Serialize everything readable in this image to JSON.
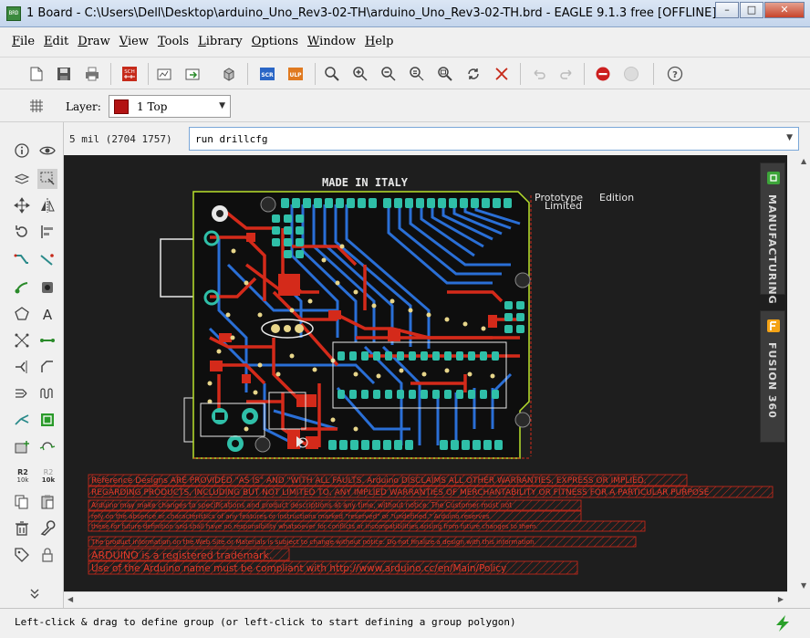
{
  "window": {
    "app_icon_label": "BRD",
    "title": "1 Board - C:\\Users\\Dell\\Desktop\\arduino_Uno_Rev3-02-TH\\arduino_Uno_Rev3-02-TH.brd - EAGLE 9.1.3 free [OFFLINE]",
    "minimize": "–",
    "maximize": "□",
    "close": "✕"
  },
  "menu": [
    {
      "first": "F",
      "rest": "ile"
    },
    {
      "first": "E",
      "rest": "dit"
    },
    {
      "first": "D",
      "rest": "raw"
    },
    {
      "first": "V",
      "rest": "iew"
    },
    {
      "first": "T",
      "rest": "ools"
    },
    {
      "first": "L",
      "rest": "ibrary"
    },
    {
      "first": "O",
      "rest": "ptions"
    },
    {
      "first": "W",
      "rest": "indow"
    },
    {
      "first": "H",
      "rest": "elp"
    }
  ],
  "toolbar": {
    "sch_label": "SCH",
    "scr_label": "SCR",
    "ulp_label": "ULP",
    "help_label": "?"
  },
  "layer": {
    "label": "Layer:",
    "value": "1 Top",
    "color": "#b31313"
  },
  "tools": {
    "r2_label": "R2",
    "r2_sub": "10k",
    "r2b_label": "R2",
    "r2b_sub": "10k",
    "text_tool": "A"
  },
  "coords": "5 mil (2704 1757)",
  "command": {
    "value": "run drillcfg"
  },
  "board": {
    "made_in": "MADE IN ITALY",
    "prototype": "Prototype",
    "limited": "Limited",
    "edition": "Edition",
    "disclaimer": [
      "Reference Designs ARE PROVIDED \"AS IS\" AND \"WITH ALL FAULTS. Arduino DISCLAIMS ALL OTHER WARRANTIES, EXPRESS OR IMPLIED,",
      "REGARDING PRODUCTS, INCLUDING BUT NOT LIMITED TO, ANY IMPLIED WARRANTIES OF MERCHANTABILITY OR FITNESS FOR A PARTICULAR PURPOSE",
      "Arduino may make changes to specifications and product descriptions at any time, without notice. The Customer must not",
      "rely on the absence or characteristics of any features or instructions marked \"reserved\" or \"undefined.\" Arduino reserves",
      "these for future definition and shall have no responsibility whatsoever for conflicts or incompatibilities arising from future changes to them.",
      "The product information on the Web Site or Materials is subject to change without notice. Do not finalize a design with this information.",
      "ARDUINO is a registered trademark.",
      "Use of the Arduino name must be compliant with http://www.arduino.cc/en/Main/Policy"
    ]
  },
  "side_tabs": {
    "manufacturing": "MANUFACTURING",
    "fusion": "FUSION 360"
  },
  "status": {
    "text": "Left-click & drag to define group (or left-click to start defining a group polygon)"
  },
  "colors": {
    "canvas_bg": "#1e1e1e",
    "top_copper": "#d42a1a",
    "bottom_copper": "#2a6fd6",
    "pad": "#2fbfa8",
    "outline": "#b8e02c",
    "silkscreen": "#e8e8e8"
  }
}
